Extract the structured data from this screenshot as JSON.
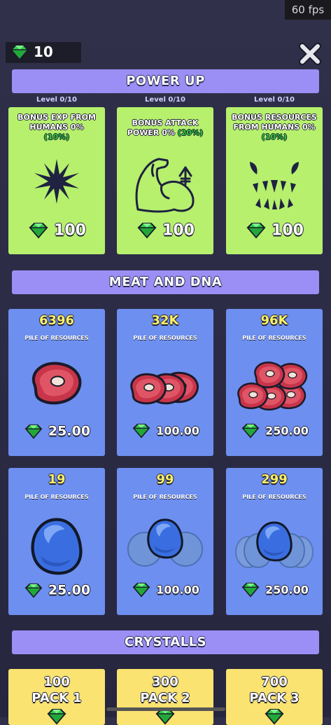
{
  "fps": "60 fps",
  "gems": "10",
  "sections": {
    "power_up": "POWER UP",
    "meat_dna": "MEAT AND DNA",
    "crystalls": "CRYSTALLS"
  },
  "power_ups": [
    {
      "level": "Level 0/10",
      "title": "BONUS EXP FROM HUMANS 0%",
      "bonus": "(10%)",
      "price": "100",
      "icon": "burst-icon"
    },
    {
      "level": "Level 0/10",
      "title": "BONUS ATTACK POWER 0%",
      "bonus": "(20%)",
      "price": "100",
      "icon": "muscle-arm-icon"
    },
    {
      "level": "Level 0/10",
      "title": "BONUS RESOURCES FROM HUMANS 0%",
      "bonus": "(10%)",
      "price": "100",
      "icon": "fangs-icon"
    }
  ],
  "resources": [
    {
      "amount": "6396",
      "label": "PILE OF RESOURCES",
      "price": "25.00",
      "icon": "meat-icon"
    },
    {
      "amount": "32K",
      "label": "PILE OF RESOURCES",
      "price": "100.00",
      "icon": "meat-stack-icon"
    },
    {
      "amount": "96K",
      "label": "PILE OF RESOURCES",
      "price": "250.00",
      "icon": "meat-pile-icon"
    },
    {
      "amount": "19",
      "label": "PILE OF RESOURCES",
      "price": "25.00",
      "icon": "dna-egg-icon"
    },
    {
      "amount": "99",
      "label": "PILE OF RESOURCES",
      "price": "100.00",
      "icon": "dna-egg-stack-icon"
    },
    {
      "amount": "299",
      "label": "PILE OF RESOURCES",
      "price": "250.00",
      "icon": "dna-egg-pile-icon"
    }
  ],
  "packs": [
    {
      "amount": "100",
      "name": "PACK 1"
    },
    {
      "amount": "300",
      "name": "PACK 2"
    },
    {
      "amount": "700",
      "name": "PACK 3"
    }
  ]
}
